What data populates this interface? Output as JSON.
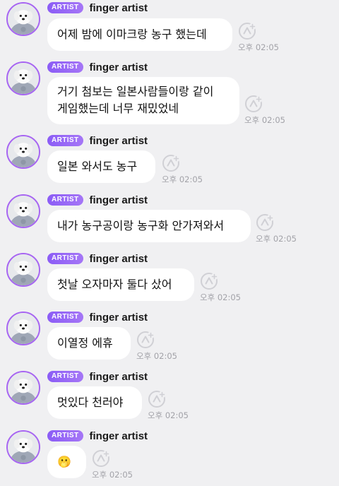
{
  "messages": [
    {
      "badge": "ARTIST",
      "name": "finger artist",
      "lines": [
        "어제 밤에 이마크랑 농구 했는데"
      ],
      "time": "오후 02:05"
    },
    {
      "badge": "ARTIST",
      "name": "finger artist",
      "lines": [
        "거기 첨보는 일본사람들이랑 같이",
        "게임했는데 너무 재밌었네"
      ],
      "time": "오후 02:05"
    },
    {
      "badge": "ARTIST",
      "name": "finger artist",
      "lines": [
        "일본 와서도 농구"
      ],
      "time": "오후 02:05"
    },
    {
      "badge": "ARTIST",
      "name": "finger artist",
      "lines": [
        "내가 농구공이랑 농구화 안가져와서"
      ],
      "time": "오후 02:05"
    },
    {
      "badge": "ARTIST",
      "name": "finger artist",
      "lines": [
        "첫날 오자마자 둘다 샀어"
      ],
      "time": "오후 02:05"
    },
    {
      "badge": "ARTIST",
      "name": "finger artist",
      "lines": [
        "이열정 에휴"
      ],
      "time": "오후 02:05"
    },
    {
      "badge": "ARTIST",
      "name": "finger artist",
      "lines": [
        "멋있다 천러야"
      ],
      "time": "오후 02:05"
    },
    {
      "badge": "ARTIST",
      "name": "finger artist",
      "lines": [
        "🫢"
      ],
      "time": "오후 02:05"
    }
  ],
  "icons": {
    "avatar": "dog-avatar",
    "reaction": "reaction-icon"
  },
  "colors": {
    "background": "#f0f0f2",
    "bubble": "#ffffff",
    "badge": "#8b5cf6",
    "avatar_ring": "#a765f2",
    "time": "#a2a2a8"
  }
}
